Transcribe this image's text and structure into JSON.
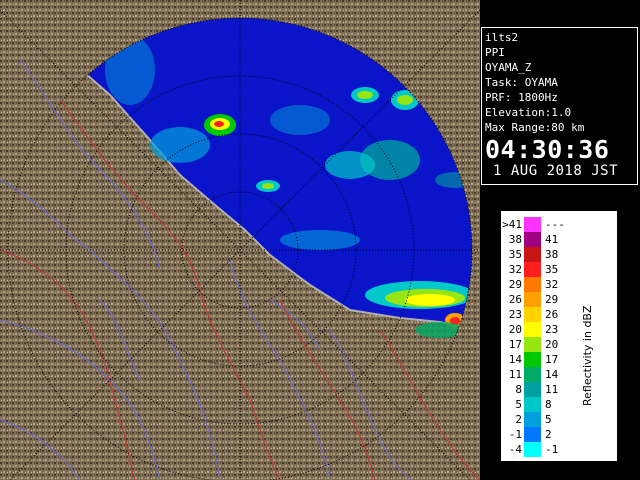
{
  "info": {
    "program": "ilts2",
    "product": "PPI",
    "site": "OYAMA_Z",
    "task": "Task: OYAMA",
    "prf": "PRF: 1800Hz",
    "elevation": "Elevation:1.0",
    "max_range": "Max Range:80 km",
    "time": "04:30:36",
    "date": " 1 AUG 2018 JST"
  },
  "legend": {
    "title": "Reflectivity in dBZ",
    "rows": [
      {
        "lower": ">41",
        "upper": "---",
        "color": "#ff33ff"
      },
      {
        "lower": "38",
        "upper": "41",
        "color": "#a00080"
      },
      {
        "lower": "35",
        "upper": "38",
        "color": "#c81414"
      },
      {
        "lower": "32",
        "upper": "35",
        "color": "#ff1e1e"
      },
      {
        "lower": "29",
        "upper": "32",
        "color": "#ff7800"
      },
      {
        "lower": "26",
        "upper": "29",
        "color": "#ffa000"
      },
      {
        "lower": "23",
        "upper": "26",
        "color": "#ffd200"
      },
      {
        "lower": "20",
        "upper": "23",
        "color": "#ffff00"
      },
      {
        "lower": "17",
        "upper": "20",
        "color": "#96e614"
      },
      {
        "lower": "14",
        "upper": "17",
        "color": "#00c800"
      },
      {
        "lower": "11",
        "upper": "14",
        "color": "#00aa64"
      },
      {
        "lower": "8",
        "upper": "11",
        "color": "#00a0a0"
      },
      {
        "lower": "5",
        "upper": "8",
        "color": "#00c8c8"
      },
      {
        "lower": "2",
        "upper": "5",
        "color": "#00a0dc"
      },
      {
        "lower": "-1",
        "upper": "2",
        "color": "#0078ff"
      },
      {
        "lower": "-4",
        "upper": "-1",
        "color": "#00ffff"
      }
    ]
  },
  "radar_colors": {
    "sea_background": "#0000c8",
    "land": "#7a6a52",
    "rivers": "#6060e0",
    "boundaries": "#c03030",
    "range_rings": "#000000"
  }
}
